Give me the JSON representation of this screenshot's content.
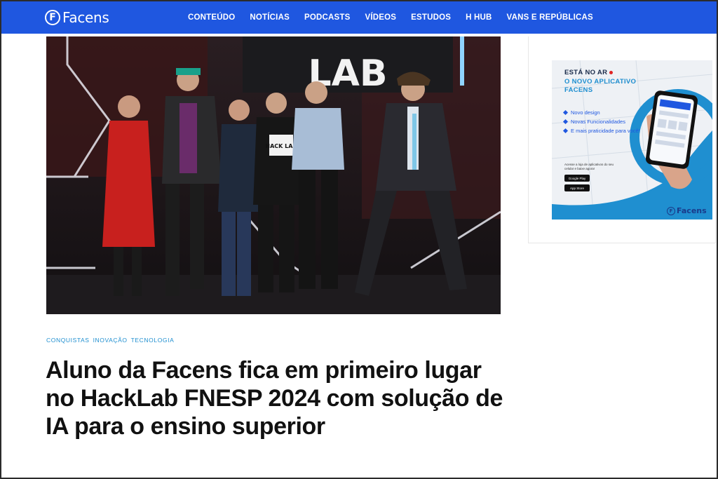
{
  "header": {
    "logo_mark": "F",
    "logo_text": "Facens",
    "nav": [
      "CONTEÚDO",
      "NOTÍCIAS",
      "PODCASTS",
      "VÍDEOS",
      "ESTUDOS",
      "H HUB",
      "VANS E REPÚBLICAS"
    ]
  },
  "hero": {
    "sign_text": "LAB",
    "badge_text": "HACK LAB"
  },
  "article": {
    "categories": [
      "CONQUISTAS",
      "INOVAÇÃO",
      "TECNOLOGIA"
    ],
    "title": "Aluno da Facens fica em primeiro lugar no HackLab FNESP 2024 com solução de IA para o ensino superior"
  },
  "ad": {
    "headline_1": "ESTÁ NO AR",
    "headline_2": "O NOVO APLICATIVO FACENS",
    "features": [
      "Novo design",
      "Novas Funcionalidades",
      "E mais praticidade para você!"
    ],
    "store_text": "Acesse a loja de aplicativos do seu celular e baixe agora!",
    "google_play": "Google Play",
    "app_store": "App Store",
    "brand_mark": "F",
    "brand_text": "Facens"
  },
  "colors": {
    "brand_blue": "#1f57e0",
    "category_blue": "#1f8fd0",
    "ad_accent_red": "#e02424"
  }
}
